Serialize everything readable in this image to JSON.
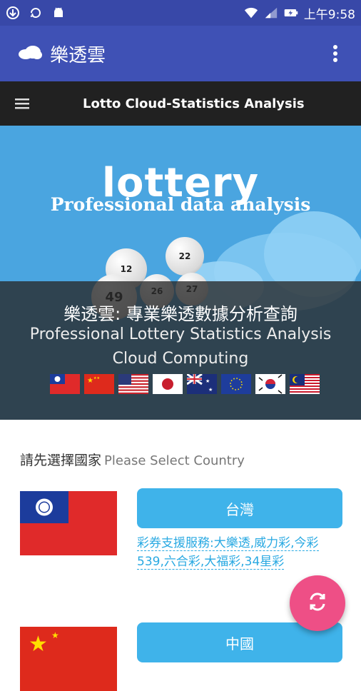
{
  "status": {
    "time": "上午9:58",
    "icons": [
      "download-icon",
      "sync-icon",
      "android-icon",
      "wifi-icon",
      "signal-icon",
      "battery-charging-icon"
    ]
  },
  "appbar": {
    "title": "樂透雲",
    "menu_icon": "more-vert-icon"
  },
  "webbar": {
    "title": "Lotto Cloud-Statistics Analysis",
    "menu_icon": "hamburger-icon"
  },
  "hero": {
    "logo_text": "lottery",
    "tagline": "Professional data analysis",
    "balls": [
      "12",
      "22",
      "49",
      "26",
      "27"
    ],
    "overlay_title": "樂透雲: 專業樂透數據分析查詢",
    "overlay_sub1": "Professional Lottery Statistics Analysis",
    "overlay_sub2": "Cloud Computing",
    "flags": [
      "taiwan",
      "china",
      "usa",
      "japan",
      "australia",
      "eu",
      "korea",
      "malaysia"
    ]
  },
  "country_select": {
    "prompt_zh": "請先選擇國家",
    "prompt_en": "Please Select Country",
    "countries": [
      {
        "name": "台灣",
        "flag": "taiwan",
        "services": "彩券支援服務:大樂透,威力彩,今彩539,六合彩,大福彩,34星彩"
      },
      {
        "name": "中國",
        "flag": "china",
        "services": ""
      }
    ]
  },
  "fab": {
    "icon": "refresh-icon"
  },
  "colors": {
    "status_bar": "#3848a8",
    "app_bar": "#3f51b5",
    "web_bar": "#212121",
    "button": "#3fb3ea",
    "fab": "#ee4f86",
    "link": "#29a9e2"
  }
}
